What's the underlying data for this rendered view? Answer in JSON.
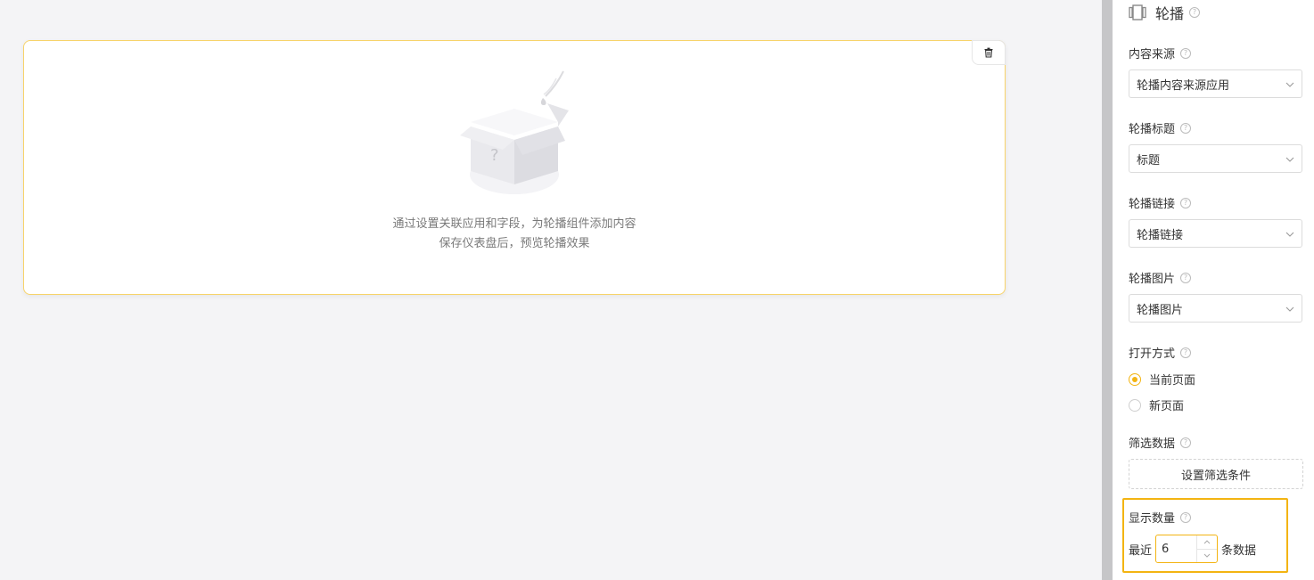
{
  "canvas": {
    "empty_line1": "通过设置关联应用和字段，为轮播组件添加内容",
    "empty_line2": "保存仪表盘后，预览轮播效果",
    "delete_icon": "trash-icon"
  },
  "panel": {
    "title": "轮播",
    "title_icon": "carousel-icon",
    "content_source": {
      "label": "内容来源",
      "value": "轮播内容来源应用"
    },
    "carousel_title": {
      "label": "轮播标题",
      "value": "标题"
    },
    "carousel_link": {
      "label": "轮播链接",
      "value": "轮播链接"
    },
    "carousel_image": {
      "label": "轮播图片",
      "value": "轮播图片"
    },
    "open_mode": {
      "label": "打开方式",
      "options": [
        "当前页面",
        "新页面"
      ],
      "selected": "当前页面"
    },
    "filter": {
      "label": "筛选数据",
      "button": "设置筛选条件"
    },
    "display_count": {
      "label": "显示数量",
      "prefix": "最近",
      "value": "6",
      "suffix": "条数据"
    }
  },
  "colors": {
    "accent": "#f3b412",
    "card_border": "#f7d36a"
  }
}
